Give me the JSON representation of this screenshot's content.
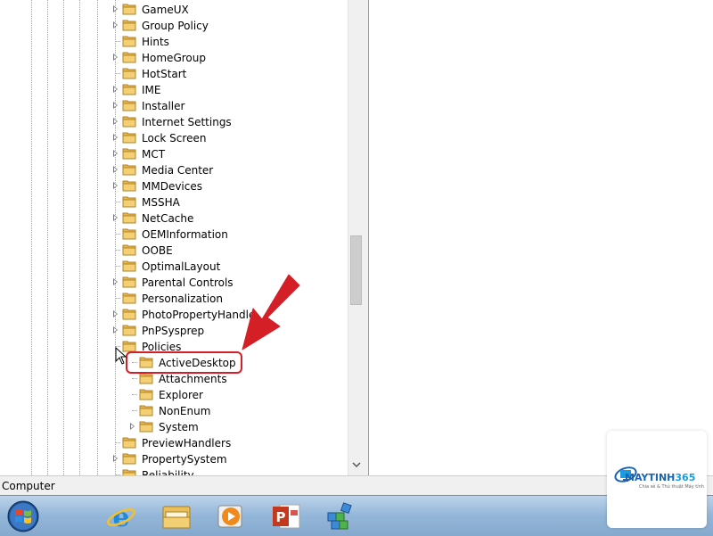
{
  "tree": {
    "items": [
      {
        "label": "GameUX",
        "level": 1,
        "expander": true
      },
      {
        "label": "Group Policy",
        "level": 1,
        "expander": true
      },
      {
        "label": "Hints",
        "level": 1,
        "expander": false
      },
      {
        "label": "HomeGroup",
        "level": 1,
        "expander": true
      },
      {
        "label": "HotStart",
        "level": 1,
        "expander": false
      },
      {
        "label": "IME",
        "level": 1,
        "expander": true
      },
      {
        "label": "Installer",
        "level": 1,
        "expander": true
      },
      {
        "label": "Internet Settings",
        "level": 1,
        "expander": true
      },
      {
        "label": "Lock Screen",
        "level": 1,
        "expander": true
      },
      {
        "label": "MCT",
        "level": 1,
        "expander": true
      },
      {
        "label": "Media Center",
        "level": 1,
        "expander": true
      },
      {
        "label": "MMDevices",
        "level": 1,
        "expander": true
      },
      {
        "label": "MSSHA",
        "level": 1,
        "expander": false
      },
      {
        "label": "NetCache",
        "level": 1,
        "expander": true
      },
      {
        "label": "OEMInformation",
        "level": 1,
        "expander": false
      },
      {
        "label": "OOBE",
        "level": 1,
        "expander": false
      },
      {
        "label": "OptimalLayout",
        "level": 1,
        "expander": false
      },
      {
        "label": "Parental Controls",
        "level": 1,
        "expander": true
      },
      {
        "label": "Personalization",
        "level": 1,
        "expander": false
      },
      {
        "label": "PhotoPropertyHandle",
        "level": 1,
        "expander": true
      },
      {
        "label": "PnPSysprep",
        "level": 1,
        "expander": true
      },
      {
        "label": "Policies",
        "level": 1,
        "expander": false,
        "expanded": true
      },
      {
        "label": "ActiveDesktop",
        "level": 2,
        "expander": false
      },
      {
        "label": "Attachments",
        "level": 2,
        "expander": false
      },
      {
        "label": "Explorer",
        "level": 2,
        "expander": false
      },
      {
        "label": "NonEnum",
        "level": 2,
        "expander": false
      },
      {
        "label": "System",
        "level": 2,
        "expander": true
      },
      {
        "label": "PreviewHandlers",
        "level": 1,
        "expander": false
      },
      {
        "label": "PropertySystem",
        "level": 1,
        "expander": true
      },
      {
        "label": "Reliability",
        "level": 1,
        "expander": false
      }
    ]
  },
  "status_bar": {
    "text": "Computer"
  },
  "taskbar": {
    "items": [
      {
        "name": "start-button",
        "icon": "windows-logo"
      },
      {
        "name": "internet-explorer",
        "icon": "ie-icon"
      },
      {
        "name": "file-explorer",
        "icon": "folder-icon"
      },
      {
        "name": "media-player",
        "icon": "media-player-icon"
      },
      {
        "name": "powerpoint",
        "icon": "powerpoint-icon"
      },
      {
        "name": "registry-editor",
        "icon": "regedit-icon"
      }
    ]
  },
  "watermark": {
    "brand": "MAYTINH",
    "brand_num": "365",
    "tagline": "Chia sẻ & Thủ thuật Máy tính"
  },
  "colors": {
    "highlight": "#d51f26",
    "folder": "#e8b64a",
    "taskbar": "#93b6d8"
  }
}
